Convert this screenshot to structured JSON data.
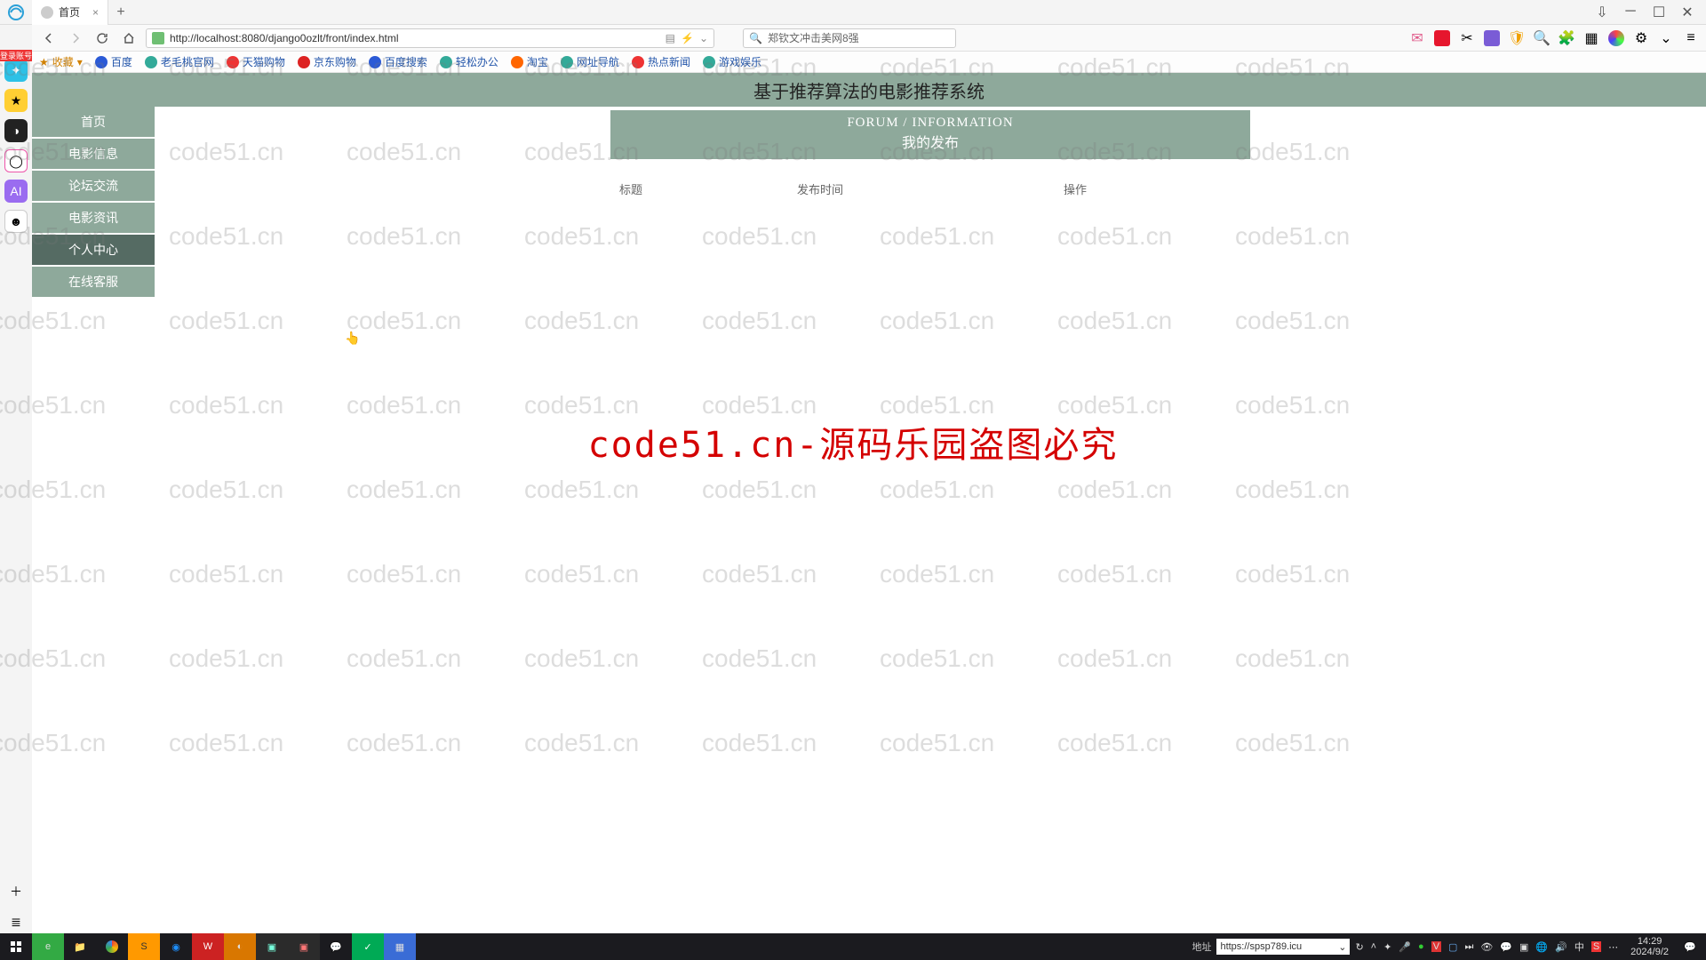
{
  "browser": {
    "tab_title": "首页",
    "url": "http://localhost:8080/django0ozlt/front/index.html",
    "search_placeholder": "郑钦文冲击美网8强",
    "bookmarks_label": "收藏",
    "bookmarks": [
      "百度",
      "老毛桃官网",
      "天猫购物",
      "京东购物",
      "百度搜索",
      "轻松办公",
      "淘宝",
      "网址导航",
      "热点新闻",
      "游戏娱乐"
    ]
  },
  "app": {
    "title": "基于推荐算法的电影推荐系统",
    "nav": [
      {
        "label": "首页",
        "active": false
      },
      {
        "label": "电影信息",
        "active": false
      },
      {
        "label": "论坛交流",
        "active": false
      },
      {
        "label": "电影资讯",
        "active": false
      },
      {
        "label": "个人中心",
        "active": true
      },
      {
        "label": "在线客服",
        "active": false
      }
    ],
    "panel": {
      "title_en": "FORUM / INFORMATION",
      "title_cn": "我的发布",
      "columns": [
        "标题",
        "发布时间",
        "操作"
      ]
    }
  },
  "watermark": {
    "repeat": "code51.cn",
    "center": "code51.cn-源码乐园盗图必究"
  },
  "taskbar": {
    "addr_label": "地址",
    "addr_value": "https://spsp789.icu",
    "time": "14:29",
    "date": "2024/9/2",
    "ime": "中"
  },
  "leftdock_badge": "登录账号"
}
